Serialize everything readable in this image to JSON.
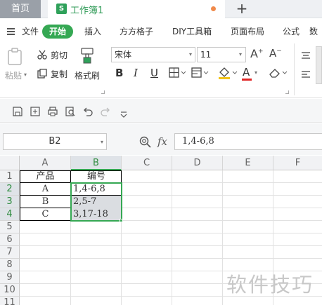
{
  "tabs": {
    "home": "首页",
    "doc_icon": "S",
    "doc_title": "工作簿1",
    "new_tab": "+"
  },
  "menu": {
    "file": "文件",
    "active": "开始",
    "items": [
      "插入",
      "方方格子",
      "DIY工具箱",
      "页面布局",
      "公式",
      "数"
    ]
  },
  "ribbon": {
    "paste": "粘贴",
    "cut": "剪切",
    "copy": "复制",
    "format_painter": "格式刷",
    "font_name": "宋体",
    "font_size": "11",
    "bold": "B",
    "italic": "I",
    "underline": "U",
    "grow": "A",
    "shrink": "A",
    "font_color_letter": "A"
  },
  "formula_bar": {
    "cell_ref": "B2",
    "fx": "fx",
    "value": "1,4-6,8"
  },
  "grid": {
    "columns": [
      "A",
      "B",
      "C",
      "D",
      "E",
      "F"
    ],
    "rows": [
      "1",
      "2",
      "3",
      "4",
      "5",
      "6",
      "7",
      "8",
      "9",
      "10",
      "11"
    ],
    "cells": {
      "A1": "产品",
      "B1": "编号",
      "A2": "A",
      "B2": "1,4-6,8",
      "A3": "B",
      "B3": "2,5-7",
      "A4": "C",
      "B4": "3,17-18"
    }
  },
  "watermark": "软件技巧",
  "colors": {
    "accent": "#35a853",
    "tab_active_text": "#2e9a56"
  },
  "icons": [
    "menu-icon",
    "paste-icon",
    "scissors-icon",
    "copy-icon",
    "format-painter-icon",
    "save-icon",
    "undo-icon",
    "redo-icon",
    "print-icon",
    "zoom-icon"
  ]
}
